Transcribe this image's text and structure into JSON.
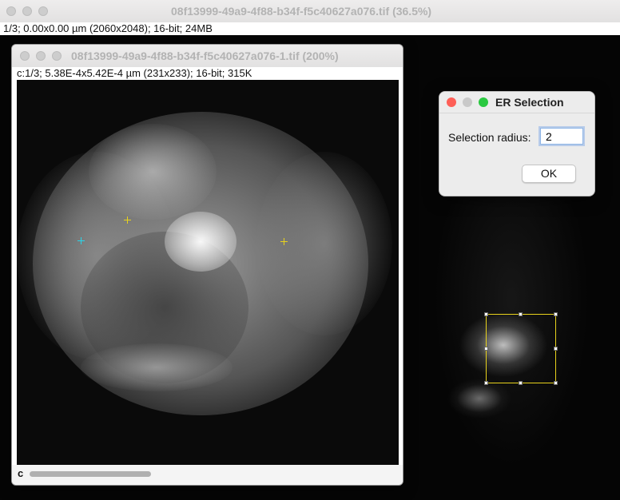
{
  "main_window": {
    "title": "08f13999-49a9-4f88-b34f-f5c40627a076.tif (36.5%)",
    "info": "1/3; 0.00x0.00 µm (2060x2048); 16-bit; 24MB"
  },
  "image_window": {
    "title": "08f13999-49a9-4f88-b34f-f5c40627a076-1.tif (200%)",
    "info": "c:1/3; 5.38E-4x5.42E-4 µm (231x233); 16-bit; 315K",
    "channel_label": "c",
    "markers": [
      {
        "name": "yellow-marker-1",
        "color": "#e8d21c"
      },
      {
        "name": "yellow-marker-2",
        "color": "#e8d21c"
      },
      {
        "name": "cyan-marker",
        "color": "#2ad4e8"
      }
    ]
  },
  "dialog": {
    "title": "ER Selection",
    "label": "Selection radius:",
    "value": "2",
    "ok_label": "OK"
  },
  "colors": {
    "close": "#fe5f57",
    "minimize": "#c9c9c9",
    "zoom": "#2ac840",
    "roi": "#e8d21c"
  },
  "icons": {
    "window_controls": [
      "close-icon",
      "minimize-icon",
      "zoom-icon"
    ]
  }
}
